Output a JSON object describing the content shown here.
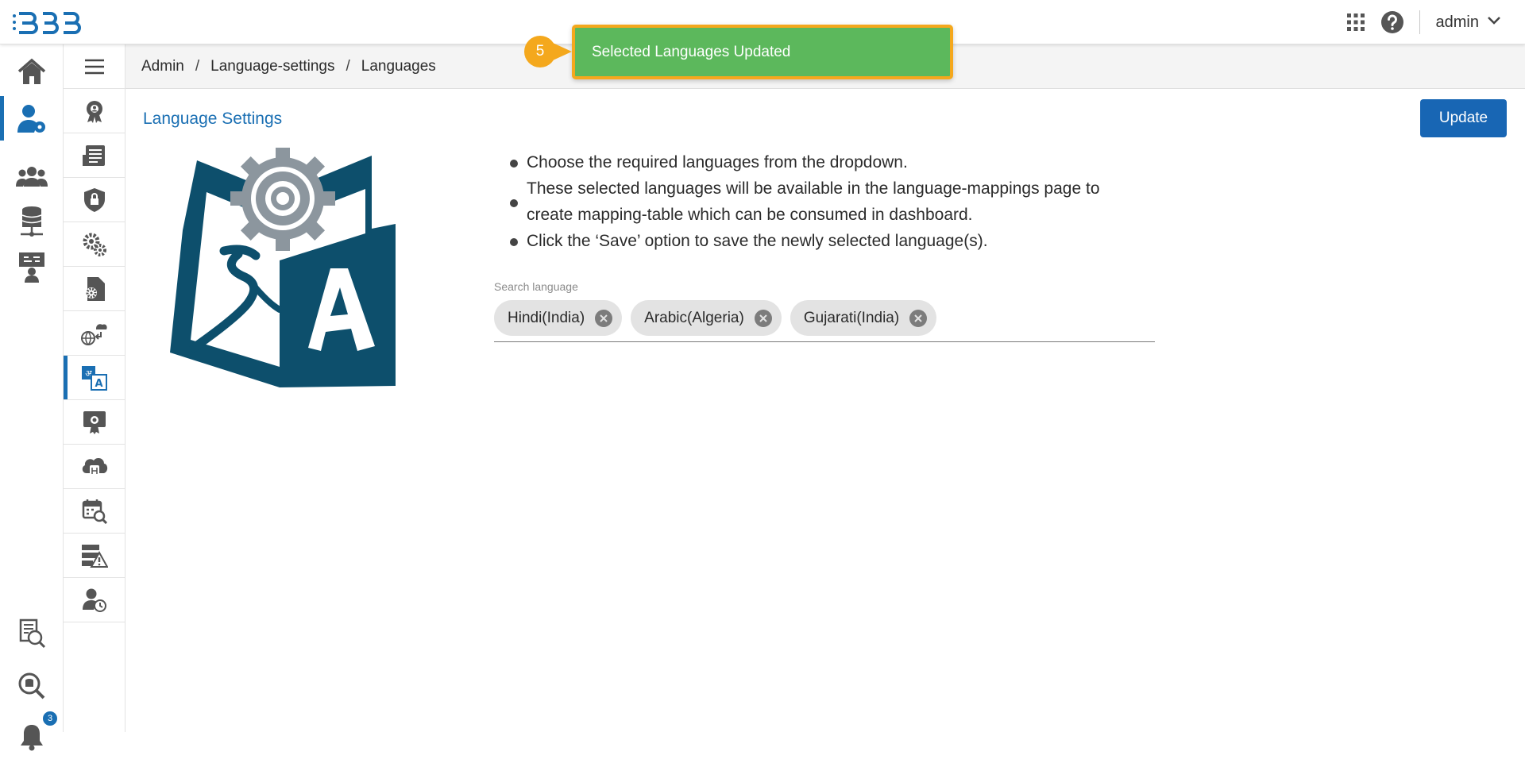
{
  "topbar": {
    "user_name": "admin",
    "icons": [
      "apps-grid-icon",
      "help-icon",
      "chevron-down-icon"
    ]
  },
  "rail": {
    "items": [
      "home-icon",
      "admin-user-settings-icon",
      "users-group-icon",
      "data-center-icon",
      "presentation-user-icon",
      "report-search-icon",
      "data-search-icon",
      "bell-icon"
    ],
    "notification_count": "3"
  },
  "subnav": {
    "items": [
      "configuration-badge-icon",
      "document-settings-icon",
      "shield-lock-icon",
      "gears-icon",
      "file-settings-icon",
      "globe-transfer-icon",
      "language-icon",
      "certificate-icon",
      "cloud-database-icon",
      "calendar-search-icon",
      "server-warning-icon",
      "user-history-icon"
    ],
    "active_index": 6
  },
  "breadcrumb": {
    "items": [
      "Admin",
      "Language-settings",
      "Languages"
    ],
    "separator": "/"
  },
  "toast": {
    "message": "Selected Languages Updated",
    "step": "5",
    "color": "#5cb85c",
    "highlight": "#f4a81d"
  },
  "main": {
    "title": "Language Settings",
    "update_label": "Update",
    "bullets": [
      "Choose the required languages from the dropdown.",
      "These selected languages will be available in the language-mappings page to create mapping-table which can be consumed in dashboard.",
      "Click the ‘Save’ option to save the newly selected language(s)."
    ],
    "search_label": "Search language",
    "selected_languages": [
      "Hindi(India)",
      "Arabic(Algeria)",
      "Gujarati(India)"
    ]
  },
  "colors": {
    "accent": "#1a6fb3",
    "button": "#1866b4",
    "illustration": "#0d4f6c"
  }
}
